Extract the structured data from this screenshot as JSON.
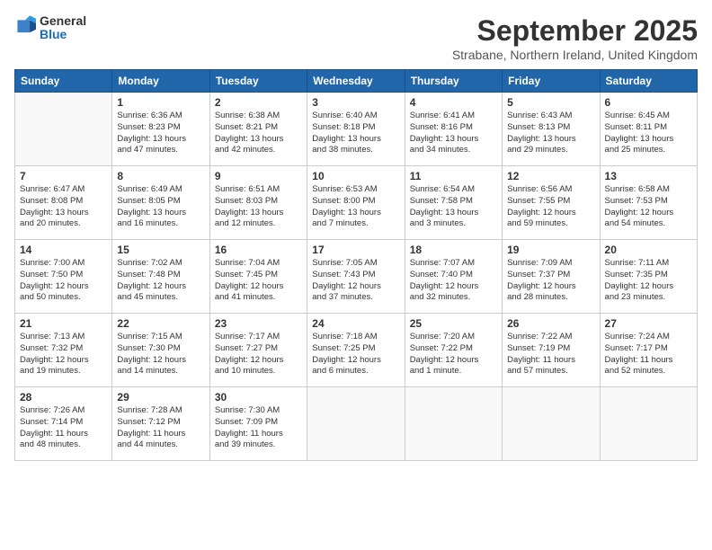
{
  "header": {
    "logo_general": "General",
    "logo_blue": "Blue",
    "month_title": "September 2025",
    "subtitle": "Strabane, Northern Ireland, United Kingdom"
  },
  "days_of_week": [
    "Sunday",
    "Monday",
    "Tuesday",
    "Wednesday",
    "Thursday",
    "Friday",
    "Saturday"
  ],
  "weeks": [
    [
      {
        "day": "",
        "info": ""
      },
      {
        "day": "1",
        "info": "Sunrise: 6:36 AM\nSunset: 8:23 PM\nDaylight: 13 hours\nand 47 minutes."
      },
      {
        "day": "2",
        "info": "Sunrise: 6:38 AM\nSunset: 8:21 PM\nDaylight: 13 hours\nand 42 minutes."
      },
      {
        "day": "3",
        "info": "Sunrise: 6:40 AM\nSunset: 8:18 PM\nDaylight: 13 hours\nand 38 minutes."
      },
      {
        "day": "4",
        "info": "Sunrise: 6:41 AM\nSunset: 8:16 PM\nDaylight: 13 hours\nand 34 minutes."
      },
      {
        "day": "5",
        "info": "Sunrise: 6:43 AM\nSunset: 8:13 PM\nDaylight: 13 hours\nand 29 minutes."
      },
      {
        "day": "6",
        "info": "Sunrise: 6:45 AM\nSunset: 8:11 PM\nDaylight: 13 hours\nand 25 minutes."
      }
    ],
    [
      {
        "day": "7",
        "info": "Sunrise: 6:47 AM\nSunset: 8:08 PM\nDaylight: 13 hours\nand 20 minutes."
      },
      {
        "day": "8",
        "info": "Sunrise: 6:49 AM\nSunset: 8:05 PM\nDaylight: 13 hours\nand 16 minutes."
      },
      {
        "day": "9",
        "info": "Sunrise: 6:51 AM\nSunset: 8:03 PM\nDaylight: 13 hours\nand 12 minutes."
      },
      {
        "day": "10",
        "info": "Sunrise: 6:53 AM\nSunset: 8:00 PM\nDaylight: 13 hours\nand 7 minutes."
      },
      {
        "day": "11",
        "info": "Sunrise: 6:54 AM\nSunset: 7:58 PM\nDaylight: 13 hours\nand 3 minutes."
      },
      {
        "day": "12",
        "info": "Sunrise: 6:56 AM\nSunset: 7:55 PM\nDaylight: 12 hours\nand 59 minutes."
      },
      {
        "day": "13",
        "info": "Sunrise: 6:58 AM\nSunset: 7:53 PM\nDaylight: 12 hours\nand 54 minutes."
      }
    ],
    [
      {
        "day": "14",
        "info": "Sunrise: 7:00 AM\nSunset: 7:50 PM\nDaylight: 12 hours\nand 50 minutes."
      },
      {
        "day": "15",
        "info": "Sunrise: 7:02 AM\nSunset: 7:48 PM\nDaylight: 12 hours\nand 45 minutes."
      },
      {
        "day": "16",
        "info": "Sunrise: 7:04 AM\nSunset: 7:45 PM\nDaylight: 12 hours\nand 41 minutes."
      },
      {
        "day": "17",
        "info": "Sunrise: 7:05 AM\nSunset: 7:43 PM\nDaylight: 12 hours\nand 37 minutes."
      },
      {
        "day": "18",
        "info": "Sunrise: 7:07 AM\nSunset: 7:40 PM\nDaylight: 12 hours\nand 32 minutes."
      },
      {
        "day": "19",
        "info": "Sunrise: 7:09 AM\nSunset: 7:37 PM\nDaylight: 12 hours\nand 28 minutes."
      },
      {
        "day": "20",
        "info": "Sunrise: 7:11 AM\nSunset: 7:35 PM\nDaylight: 12 hours\nand 23 minutes."
      }
    ],
    [
      {
        "day": "21",
        "info": "Sunrise: 7:13 AM\nSunset: 7:32 PM\nDaylight: 12 hours\nand 19 minutes."
      },
      {
        "day": "22",
        "info": "Sunrise: 7:15 AM\nSunset: 7:30 PM\nDaylight: 12 hours\nand 14 minutes."
      },
      {
        "day": "23",
        "info": "Sunrise: 7:17 AM\nSunset: 7:27 PM\nDaylight: 12 hours\nand 10 minutes."
      },
      {
        "day": "24",
        "info": "Sunrise: 7:18 AM\nSunset: 7:25 PM\nDaylight: 12 hours\nand 6 minutes."
      },
      {
        "day": "25",
        "info": "Sunrise: 7:20 AM\nSunset: 7:22 PM\nDaylight: 12 hours\nand 1 minute."
      },
      {
        "day": "26",
        "info": "Sunrise: 7:22 AM\nSunset: 7:19 PM\nDaylight: 11 hours\nand 57 minutes."
      },
      {
        "day": "27",
        "info": "Sunrise: 7:24 AM\nSunset: 7:17 PM\nDaylight: 11 hours\nand 52 minutes."
      }
    ],
    [
      {
        "day": "28",
        "info": "Sunrise: 7:26 AM\nSunset: 7:14 PM\nDaylight: 11 hours\nand 48 minutes."
      },
      {
        "day": "29",
        "info": "Sunrise: 7:28 AM\nSunset: 7:12 PM\nDaylight: 11 hours\nand 44 minutes."
      },
      {
        "day": "30",
        "info": "Sunrise: 7:30 AM\nSunset: 7:09 PM\nDaylight: 11 hours\nand 39 minutes."
      },
      {
        "day": "",
        "info": ""
      },
      {
        "day": "",
        "info": ""
      },
      {
        "day": "",
        "info": ""
      },
      {
        "day": "",
        "info": ""
      }
    ]
  ]
}
